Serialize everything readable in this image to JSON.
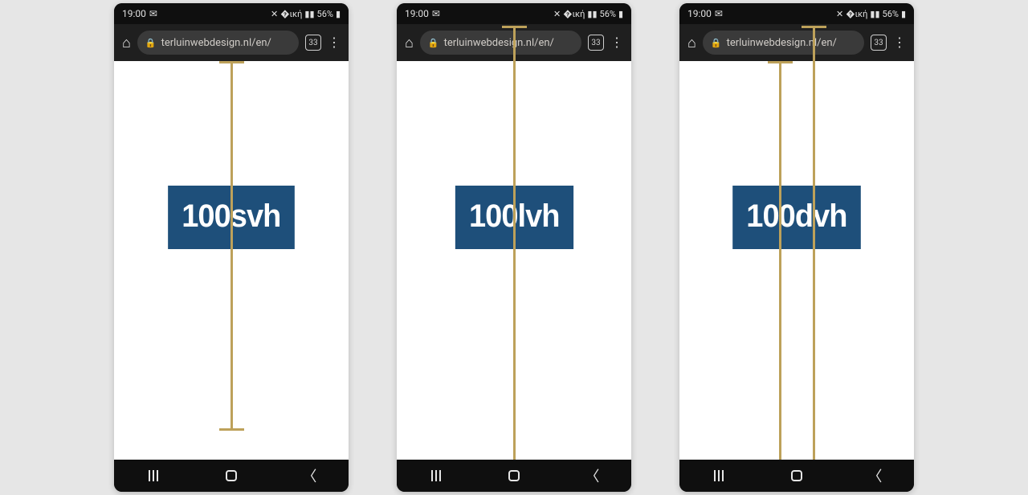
{
  "status": {
    "time": "19:00",
    "battery": "56%",
    "notif_icon": "✉"
  },
  "address": {
    "url": "terluinwebdesign.nl/en/",
    "tab_count": "33"
  },
  "phones": [
    {
      "label": "100svh"
    },
    {
      "label": "100lvh"
    },
    {
      "label": "100dvh"
    }
  ]
}
